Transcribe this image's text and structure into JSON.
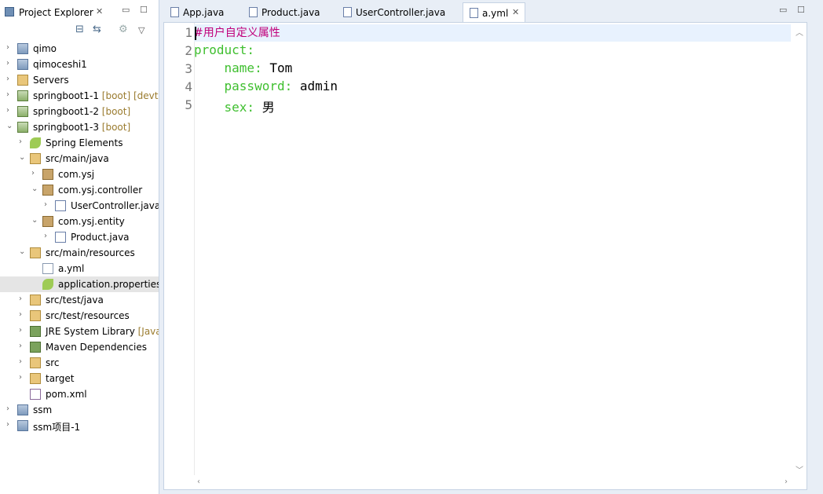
{
  "explorer": {
    "title": "Project Explorer",
    "tree": [
      {
        "label": "qimo",
        "dec": "",
        "depth": 0,
        "icon": "project-icon",
        "expanded": false
      },
      {
        "label": "qimoceshi1",
        "dec": "",
        "depth": 0,
        "icon": "project-icon",
        "expanded": false
      },
      {
        "label": "Servers",
        "dec": "",
        "depth": 0,
        "icon": "folder-icon",
        "expanded": false
      },
      {
        "label": "springboot1-1",
        "dec": "[boot] [devt",
        "depth": 0,
        "icon": "boot-project-icon",
        "expanded": false
      },
      {
        "label": "springboot1-2",
        "dec": "[boot]",
        "depth": 0,
        "icon": "boot-project-icon",
        "expanded": false
      },
      {
        "label": "springboot1-3",
        "dec": "[boot]",
        "depth": 0,
        "icon": "boot-project-icon",
        "expanded": true
      },
      {
        "label": "Spring Elements",
        "dec": "",
        "depth": 1,
        "icon": "spring-leaf-icon",
        "expanded": false
      },
      {
        "label": "src/main/java",
        "dec": "",
        "depth": 1,
        "icon": "source-folder-icon",
        "expanded": true
      },
      {
        "label": "com.ysj",
        "dec": "",
        "depth": 2,
        "icon": "package-icon",
        "expanded": false
      },
      {
        "label": "com.ysj.controller",
        "dec": "",
        "depth": 2,
        "icon": "package-icon",
        "expanded": true
      },
      {
        "label": "UserController.java",
        "dec": "",
        "depth": 3,
        "icon": "java-file-icon",
        "expanded": false
      },
      {
        "label": "com.ysj.entity",
        "dec": "",
        "depth": 2,
        "icon": "package-icon",
        "expanded": true
      },
      {
        "label": "Product.java",
        "dec": "",
        "depth": 3,
        "icon": "java-file-icon",
        "expanded": false
      },
      {
        "label": "src/main/resources",
        "dec": "",
        "depth": 1,
        "icon": "source-folder-icon",
        "expanded": true
      },
      {
        "label": "a.yml",
        "dec": "",
        "depth": 2,
        "icon": "text-file-icon",
        "expanded": null
      },
      {
        "label": "application.properties",
        "dec": "",
        "depth": 2,
        "icon": "spring-leaf-icon",
        "expanded": null,
        "selected": true
      },
      {
        "label": "src/test/java",
        "dec": "",
        "depth": 1,
        "icon": "source-folder-icon",
        "expanded": false
      },
      {
        "label": "src/test/resources",
        "dec": "",
        "depth": 1,
        "icon": "source-folder-icon",
        "expanded": false
      },
      {
        "label": "JRE System Library",
        "dec": "[Java",
        "depth": 1,
        "icon": "library-icon",
        "expanded": false
      },
      {
        "label": "Maven Dependencies",
        "dec": "",
        "depth": 1,
        "icon": "library-icon",
        "expanded": false
      },
      {
        "label": "src",
        "dec": "",
        "depth": 1,
        "icon": "folder-icon",
        "expanded": false
      },
      {
        "label": "target",
        "dec": "",
        "depth": 1,
        "icon": "folder-icon",
        "expanded": false
      },
      {
        "label": "pom.xml",
        "dec": "",
        "depth": 1,
        "icon": "pom-file-icon",
        "expanded": null
      },
      {
        "label": "ssm",
        "dec": "",
        "depth": 0,
        "icon": "project-icon",
        "expanded": false
      },
      {
        "label": "ssm项目-1",
        "dec": "",
        "depth": 0,
        "icon": "project-icon",
        "expanded": false
      }
    ]
  },
  "editor": {
    "tabs": [
      {
        "label": "App.java",
        "active": false
      },
      {
        "label": "Product.java",
        "active": false
      },
      {
        "label": "UserController.java",
        "active": false
      },
      {
        "label": "a.yml",
        "active": true
      }
    ],
    "lines": [
      {
        "num": "1",
        "key": "",
        "value": "",
        "comment": "#用户自定义属性",
        "indent": ""
      },
      {
        "num": "2",
        "key": "product:",
        "value": "",
        "comment": "",
        "indent": ""
      },
      {
        "num": "3",
        "key": "name:",
        "value": " Tom",
        "comment": "",
        "indent": "    "
      },
      {
        "num": "4",
        "key": "password:",
        "value": " admin",
        "comment": "",
        "indent": "    "
      },
      {
        "num": "5",
        "key": "sex:",
        "value": " 男",
        "comment": "",
        "indent": "    "
      }
    ]
  }
}
